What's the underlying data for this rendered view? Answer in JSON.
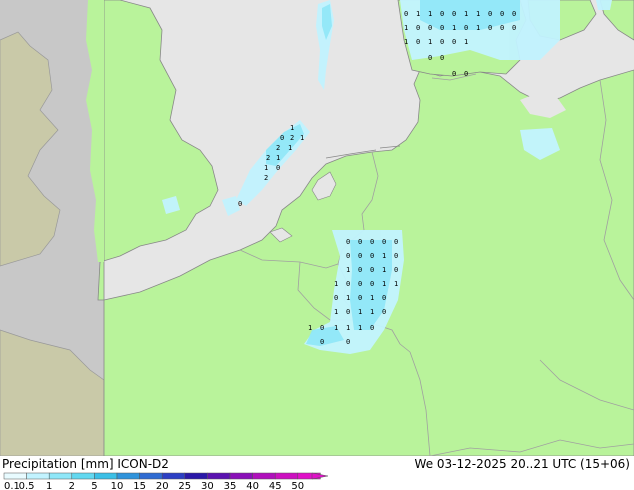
{
  "header": {
    "left_label": "Precipitation [mm]  ICON-D2",
    "right_label": "We 03-12-2025 20..21 UTC (15+06)"
  },
  "legend": {
    "ticks": [
      "0.1",
      "0.5",
      "1",
      "2",
      "5",
      "10",
      "15",
      "20",
      "25",
      "30",
      "35",
      "40",
      "45",
      "50"
    ],
    "colors": [
      "#e8fbff",
      "#c2f3ff",
      "#8fe7f8",
      "#62d8f0",
      "#3bbfe6",
      "#2f93db",
      "#2f6bd2",
      "#2c3fc4",
      "#2a18a8",
      "#5a12b0",
      "#8a10b8",
      "#b010bc",
      "#cc10c0",
      "#e010c8"
    ]
  },
  "map_colors": {
    "sea": "#e6e6e6",
    "land_domain": "#b9f39b",
    "land_outside": "#c8c8c8",
    "land_outside_east": "#c9c9a8",
    "border": "#a0a0a0",
    "coast": "#888888"
  },
  "precip_values": {
    "north_germany": [
      "0",
      "1",
      "1",
      "0",
      "0",
      "1",
      "1",
      "0",
      "0",
      "0",
      "1",
      "0",
      "0",
      "0",
      "1",
      "0",
      "1",
      "0",
      "0",
      "0",
      "1",
      "0",
      "1",
      "0",
      "0",
      "1",
      "0",
      "0",
      "0",
      "0"
    ],
    "uk_band": [
      "1",
      "0",
      "2",
      "1",
      "2",
      "1",
      "2",
      "1",
      "1",
      "0",
      "2",
      "0"
    ],
    "belgium": [
      "0",
      "0",
      "0",
      "0",
      "0",
      "0",
      "0",
      "0",
      "1",
      "0",
      "1",
      "0",
      "0",
      "1",
      "0",
      "1",
      "0",
      "0",
      "0",
      "1",
      "1",
      "0",
      "1",
      "0",
      "1",
      "0",
      "1",
      "0",
      "1",
      "1",
      "0",
      "1",
      "0",
      "1",
      "1",
      "1",
      "0",
      "0",
      "0"
    ]
  }
}
